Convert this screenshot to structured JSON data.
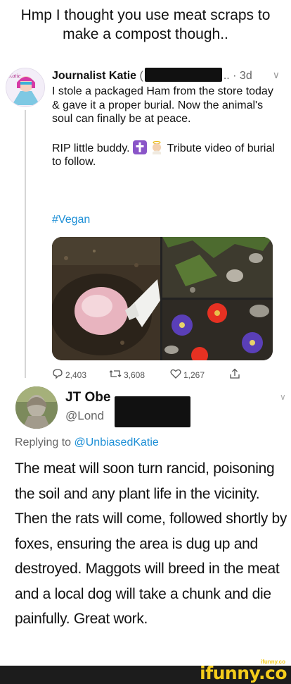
{
  "caption": "Hmp I thought you use meat scraps to make a compost though..",
  "tweet1": {
    "avatar_label": "Katie",
    "name": "Journalist Katie",
    "handle_prefix": "(",
    "handle_suffix": "..",
    "time": "· 3d",
    "text_line1": "I stole a packaged Ham from the store today & gave it a proper burial. Now the animal's soul can finally be at peace.",
    "text_line2_a": "RIP little buddy.",
    "text_line2_b": "Tribute video of burial to follow.",
    "hashtag": "#Vegan",
    "stats": {
      "replies": "2,403",
      "retweets": "3,608",
      "likes": "1,267"
    }
  },
  "tweet2": {
    "name": "JT Obe",
    "handle": "@Lond",
    "reply_prefix": "Replying to ",
    "reply_handle": "@UnbiasedKatie",
    "text": "The meat will soon turn rancid, poisoning the soil and any plant life in the vicinity. Then the rats will come, followed shortly by foxes, ensuring the area is dug up and destroyed. Maggots will breed in the meat and a local dog will take a chunk and die painfully. Great work."
  },
  "watermark": {
    "brand": "ifunny.co",
    "small": "ifunny.co"
  },
  "colors": {
    "link": "#1d8fd6",
    "watermark": "#f4cc1b"
  }
}
